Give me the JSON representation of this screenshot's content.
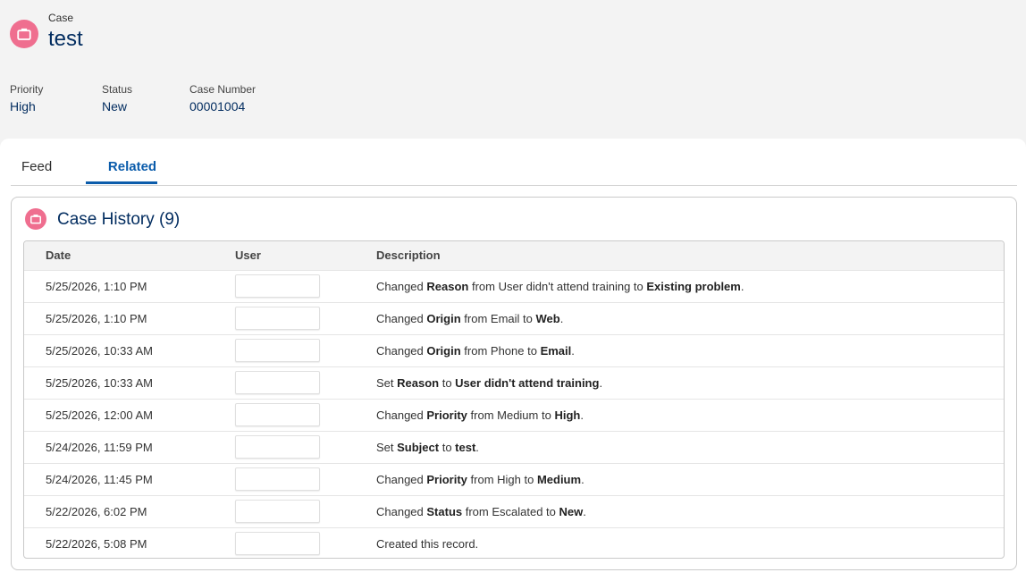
{
  "record": {
    "object_label": "Case",
    "title": "test",
    "icon": "briefcase-icon",
    "accent_color": "#ef6e8f"
  },
  "fields": [
    {
      "label": "Priority",
      "value": "High"
    },
    {
      "label": "Status",
      "value": "New"
    },
    {
      "label": "Case Number",
      "value": "00001004"
    }
  ],
  "tabs": [
    {
      "label": "Feed",
      "active": false
    },
    {
      "label": "Related",
      "active": true
    }
  ],
  "related_list": {
    "title": "Case History (9)",
    "columns": [
      "Date",
      "User",
      "Description"
    ],
    "rows": [
      {
        "date": "5/25/2026, 1:10 PM",
        "user": "",
        "desc": [
          [
            "Changed ",
            false
          ],
          [
            "Reason",
            true
          ],
          [
            " from User didn't attend training to ",
            false
          ],
          [
            "Existing problem",
            true
          ],
          [
            ".",
            false
          ]
        ]
      },
      {
        "date": "5/25/2026, 1:10 PM",
        "user": "",
        "desc": [
          [
            "Changed ",
            false
          ],
          [
            "Origin",
            true
          ],
          [
            " from Email to ",
            false
          ],
          [
            "Web",
            true
          ],
          [
            ".",
            false
          ]
        ]
      },
      {
        "date": "5/25/2026, 10:33 AM",
        "user": "",
        "desc": [
          [
            "Changed ",
            false
          ],
          [
            "Origin",
            true
          ],
          [
            " from Phone to ",
            false
          ],
          [
            "Email",
            true
          ],
          [
            ".",
            false
          ]
        ]
      },
      {
        "date": "5/25/2026, 10:33 AM",
        "user": "",
        "desc": [
          [
            "Set ",
            false
          ],
          [
            "Reason",
            true
          ],
          [
            " to ",
            false
          ],
          [
            "User didn't attend training",
            true
          ],
          [
            ".",
            false
          ]
        ]
      },
      {
        "date": "5/25/2026, 12:00 AM",
        "user": "",
        "desc": [
          [
            "Changed ",
            false
          ],
          [
            "Priority",
            true
          ],
          [
            " from Medium to ",
            false
          ],
          [
            "High",
            true
          ],
          [
            ".",
            false
          ]
        ]
      },
      {
        "date": "5/24/2026, 11:59 PM",
        "user": "",
        "desc": [
          [
            "Set ",
            false
          ],
          [
            "Subject",
            true
          ],
          [
            " to ",
            false
          ],
          [
            "test",
            true
          ],
          [
            ".",
            false
          ]
        ]
      },
      {
        "date": "5/24/2026, 11:45 PM",
        "user": "",
        "desc": [
          [
            "Changed ",
            false
          ],
          [
            "Priority",
            true
          ],
          [
            " from High to ",
            false
          ],
          [
            "Medium",
            true
          ],
          [
            ".",
            false
          ]
        ]
      },
      {
        "date": "5/22/2026, 6:02 PM",
        "user": "",
        "desc": [
          [
            "Changed ",
            false
          ],
          [
            "Status",
            true
          ],
          [
            " from Escalated to ",
            false
          ],
          [
            "New",
            true
          ],
          [
            ".",
            false
          ]
        ]
      },
      {
        "date": "5/22/2026, 5:08 PM",
        "user": "",
        "desc": [
          [
            "Created this record.",
            false
          ]
        ]
      }
    ]
  }
}
